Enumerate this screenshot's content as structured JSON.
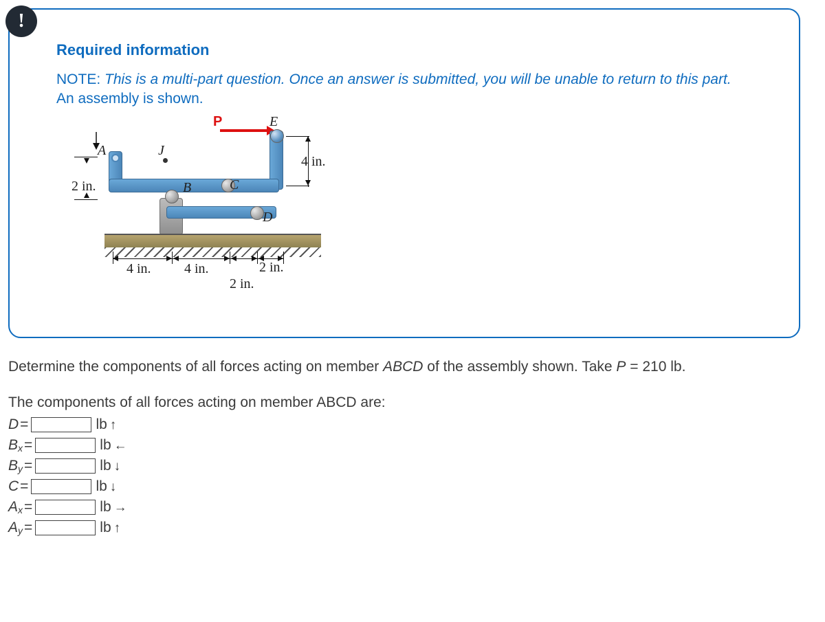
{
  "badge": "!",
  "info": {
    "title": "Required information",
    "note_label": "NOTE:",
    "note_italic": "This is a multi-part question. Once an answer is submitted, you will be unable to return to this part.",
    "assembly": "An assembly is shown."
  },
  "figure": {
    "P": "P",
    "A": "A",
    "B": "B",
    "C": "C",
    "D": "D",
    "E": "E",
    "J": "J",
    "dim_2in_left": "2 in.",
    "dim_4in_right": "4 in.",
    "dim_4in_1": "4 in.",
    "dim_4in_2": "4 in.",
    "dim_2in_3": "2 in.",
    "dim_2in_4": "2 in."
  },
  "question": {
    "pre": "Determine the components of all forces acting on member ",
    "member": "ABCD",
    "mid": " of the assembly shown. Take ",
    "pvar": "P",
    "pval": " = 210 lb."
  },
  "sub": {
    "pre": "The components of all forces acting on member ",
    "member": "ABCD",
    "post": " are:"
  },
  "answers": [
    {
      "var": "D",
      "sub": "",
      "unit": "lb",
      "arrow": "↑"
    },
    {
      "var": "B",
      "sub": "x",
      "unit": "lb",
      "arrow": "←"
    },
    {
      "var": "B",
      "sub": "y",
      "unit": "lb",
      "arrow": "↓"
    },
    {
      "var": "C",
      "sub": "",
      "unit": "lb",
      "arrow": "↓"
    },
    {
      "var": "A",
      "sub": "x",
      "unit": "lb",
      "arrow": "→"
    },
    {
      "var": "A",
      "sub": "y",
      "unit": "lb",
      "arrow": "↑"
    }
  ]
}
